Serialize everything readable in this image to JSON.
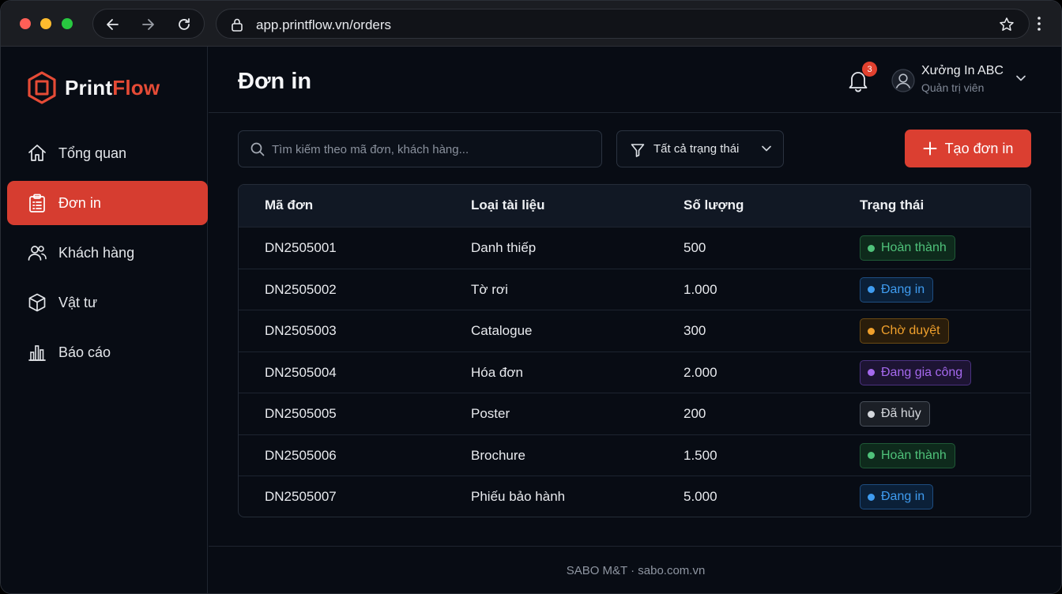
{
  "browser": {
    "url": "app.printflow.vn/orders"
  },
  "brand": {
    "part1": "Print",
    "part2": "Flow",
    "accent": "#e54b36"
  },
  "sidebar": {
    "items": [
      {
        "label": "Tổng quan",
        "icon": "home-icon",
        "active": false
      },
      {
        "label": "Đơn in",
        "icon": "clipboard-icon",
        "active": true
      },
      {
        "label": "Khách hàng",
        "icon": "users-icon",
        "active": false
      },
      {
        "label": "Vật tư",
        "icon": "box-icon",
        "active": false
      },
      {
        "label": "Báo cáo",
        "icon": "bar-chart-icon",
        "active": false
      }
    ]
  },
  "header": {
    "title": "Đơn in",
    "notifications": "3",
    "user_name": "Xưởng In ABC",
    "user_role": "Quản trị viên"
  },
  "toolbar": {
    "search_placeholder": "Tìm kiếm theo mã đơn, khách hàng...",
    "filter_label": "Tất cả trạng thái",
    "create_label": "Tạo đơn in"
  },
  "table": {
    "columns": [
      "Mã đơn",
      "Loại tài liệu",
      "Số lượng",
      "Trạng thái"
    ],
    "rows": [
      {
        "id": "DN2505001",
        "type": "Danh thiếp",
        "qty": "500",
        "status": "Hoàn thành",
        "tone": "green"
      },
      {
        "id": "DN2505002",
        "type": "Tờ rơi",
        "qty": "1.000",
        "status": "Đang in",
        "tone": "blue"
      },
      {
        "id": "DN2505003",
        "type": "Catalogue",
        "qty": "300",
        "status": "Chờ duyệt",
        "tone": "orange"
      },
      {
        "id": "DN2505004",
        "type": "Hóa đơn",
        "qty": "2.000",
        "status": "Đang gia công",
        "tone": "purple"
      },
      {
        "id": "DN2505005",
        "type": "Poster",
        "qty": "200",
        "status": "Đã hủy",
        "tone": "gray"
      },
      {
        "id": "DN2505006",
        "type": "Brochure",
        "qty": "1.500",
        "status": "Hoàn thành",
        "tone": "green"
      },
      {
        "id": "DN2505007",
        "type": "Phiếu bảo hành",
        "qty": "5.000",
        "status": "Đang in",
        "tone": "blue"
      }
    ]
  },
  "status_colors": {
    "green": {
      "text": "#4fc27a",
      "bg": "#0e2a1c",
      "border": "#1f5a37"
    },
    "blue": {
      "text": "#3f9cf0",
      "bg": "#0b2038",
      "border": "#1e4d80"
    },
    "orange": {
      "text": "#f0a02c",
      "bg": "#2a1d0b",
      "border": "#6b4a14"
    },
    "purple": {
      "text": "#a569ee",
      "bg": "#1d1433",
      "border": "#4b3280"
    },
    "gray": {
      "text": "#d4d7dc",
      "bg": "#1b1f26",
      "border": "#4a505a"
    }
  },
  "footer": {
    "text": "SABO M&T · sabo.com.vn"
  }
}
